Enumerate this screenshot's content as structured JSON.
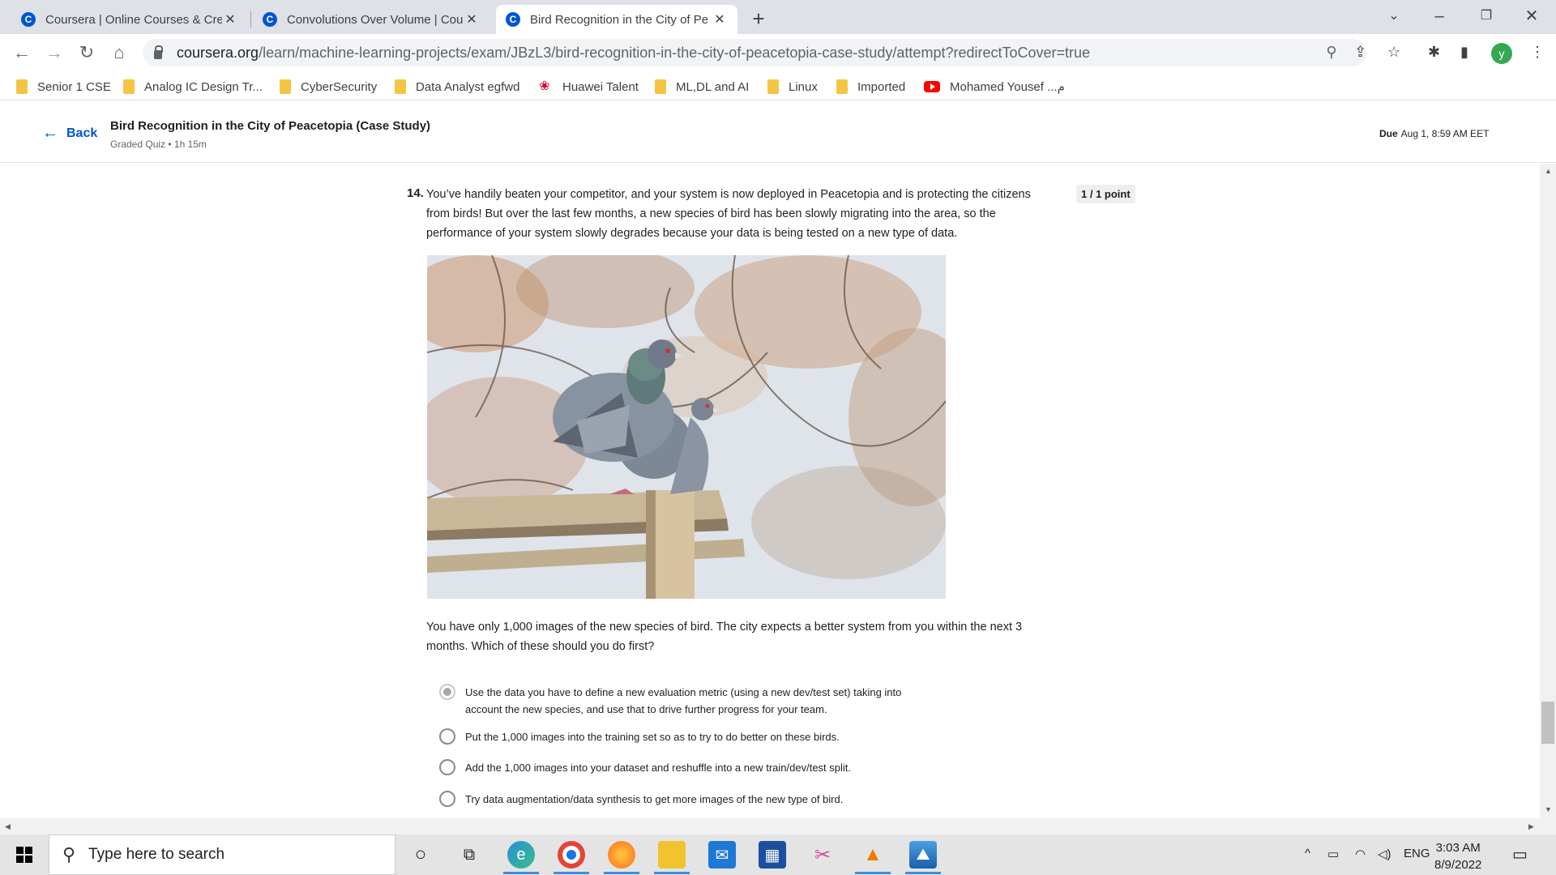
{
  "browser": {
    "tabs": [
      {
        "title": "Coursera | Online Courses & Cre",
        "favicon": "C"
      },
      {
        "title": "Convolutions Over Volume | Cou",
        "favicon": "C"
      },
      {
        "title": "Bird Recognition in the City of Pe",
        "favicon": "C"
      }
    ],
    "url_domain": "coursera.org",
    "url_path": "/learn/machine-learning-projects/exam/JBzL3/bird-recognition-in-the-city-of-peacetopia-case-study/attempt?redirectToCover=true",
    "profile_initial": "y",
    "bookmarks": [
      "Senior 1 CSE",
      "Analog IC Design Tr...",
      "CyberSecurity",
      "Data Analyst egfwd",
      "Huawei Talent",
      "ML,DL and AI",
      "Linux",
      "Imported",
      "Mohamed Yousef ...م"
    ]
  },
  "header": {
    "back_label": "Back",
    "title": "Bird Recognition in the City of Peacetopia (Case Study)",
    "subtitle": "Graded Quiz • 1h 15m",
    "due_label": "Due",
    "due_date": "Aug 1, 8:59 AM EET"
  },
  "question": {
    "number": "14.",
    "text": "You’ve handily beaten your competitor, and your system is now deployed in Peacetopia and is protecting the citizens from birds! But over the last few months, a new species of bird has been slowly migrating into the area, so the performance of your system slowly degrades because your data is being tested on a new type of data.",
    "points": "1 / 1 point",
    "prompt": "You have only 1,000 images of the new species of bird. The city expects a better system from you within the next 3 months. Which of these should you do first?",
    "options": [
      {
        "text": "Use the data you have to define a new evaluation metric (using a new dev/test set) taking into account the new species, and use that to drive further progress for your team.",
        "selected": true
      },
      {
        "text": "Put the 1,000 images into the training set so as to try to do better on these birds.",
        "selected": false
      },
      {
        "text": "Add the 1,000 images into your dataset and reshuffle into a new train/dev/test split.",
        "selected": false
      },
      {
        "text": "Try data augmentation/data synthesis to get more images of the new type of bird.",
        "selected": false
      }
    ]
  },
  "taskbar": {
    "search_placeholder": "Type here to search",
    "language": "ENG",
    "time": "3:03 AM",
    "date": "8/9/2022"
  }
}
